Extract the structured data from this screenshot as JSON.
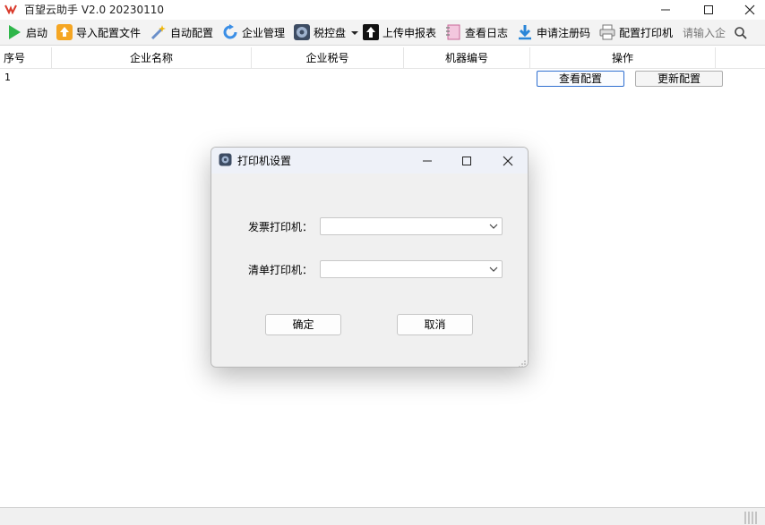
{
  "app": {
    "title": "百望云助手 V2.0  20230110",
    "window_controls": {
      "minimize": "—",
      "maximize": "☐",
      "close": "✕"
    }
  },
  "toolbar": {
    "items": [
      {
        "label": "启动",
        "icon": "play-icon"
      },
      {
        "label": "导入配置文件",
        "icon": "upload-circle-icon"
      },
      {
        "label": "自动配置",
        "icon": "magic-wand-icon"
      },
      {
        "label": "企业管理",
        "icon": "refresh-icon"
      },
      {
        "label": "税控盘",
        "icon": "disc-icon"
      },
      {
        "label": "上传申报表",
        "icon": "upload-arrow-icon"
      },
      {
        "label": "查看日志",
        "icon": "notebook-icon"
      },
      {
        "label": "申请注册码",
        "icon": "download-icon"
      },
      {
        "label": "配置打印机",
        "icon": "printer-icon"
      }
    ],
    "search_placeholder": "请输入企"
  },
  "table": {
    "columns": [
      "序号",
      "企业名称",
      "企业税号",
      "机器编号",
      "操作"
    ],
    "rows": [
      {
        "no": "1",
        "name": "",
        "tax_id": "",
        "machine_no": "",
        "actions": [
          "查看配置",
          "更新配置"
        ]
      }
    ]
  },
  "dialog": {
    "title": "打印机设置",
    "invoice_printer_label": "发票打印机：",
    "invoice_printer_value": "",
    "list_printer_label": "清单打印机：",
    "list_printer_value": "",
    "ok_label": "确定",
    "cancel_label": "取消"
  },
  "colors": {
    "accent": "#2f6fd0",
    "toolbar_bg": "#f3f3f3",
    "dialog_bg": "#f0f0f0",
    "dialog_title_bg": "#eef1f8"
  }
}
